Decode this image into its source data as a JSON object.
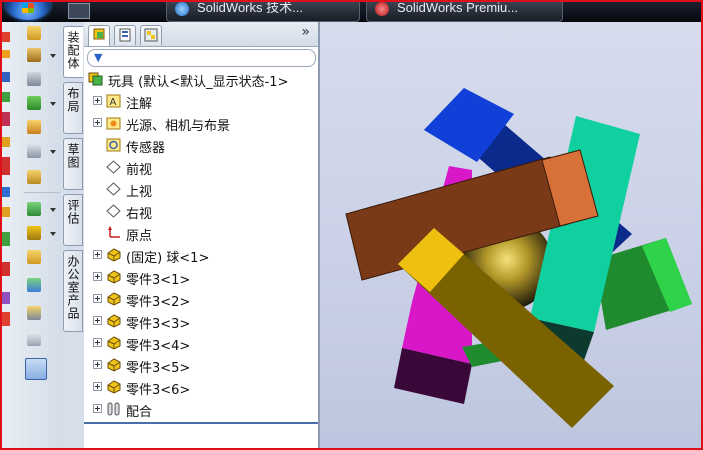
{
  "taskbar": {
    "buttons": [
      {
        "label": "SolidWorks 技术...",
        "icon_color": "#2f8be6"
      },
      {
        "label": "SolidWorks Premiu...",
        "icon_color": "#d2282a"
      }
    ]
  },
  "vertical_tabs": [
    "装配体",
    "布局",
    "草图",
    "评估",
    "办公室产品"
  ],
  "panel": {
    "tabs": [
      "feature-manager",
      "property-manager",
      "configuration-manager"
    ],
    "expand_glyph": "»"
  },
  "tree": {
    "root": "玩具  (默认<默认_显示状态-1>",
    "items": [
      {
        "label": "注解",
        "icon": "annotation-icon",
        "expandable": true
      },
      {
        "label": "光源、相机与布景",
        "icon": "lights-cameras-icon",
        "expandable": true
      },
      {
        "label": "传感器",
        "icon": "sensor-icon",
        "expandable": false
      },
      {
        "label": "前视",
        "icon": "plane-icon",
        "expandable": false
      },
      {
        "label": "上视",
        "icon": "plane-icon",
        "expandable": false
      },
      {
        "label": "右视",
        "icon": "plane-icon",
        "expandable": false
      },
      {
        "label": "原点",
        "icon": "origin-icon",
        "expandable": false
      },
      {
        "label": "(固定) 球<1>",
        "icon": "part-icon",
        "expandable": true
      },
      {
        "label": "零件3<1>",
        "icon": "part-icon",
        "expandable": true
      },
      {
        "label": "零件3<2>",
        "icon": "part-icon",
        "expandable": true
      },
      {
        "label": "零件3<3>",
        "icon": "part-icon",
        "expandable": true
      },
      {
        "label": "零件3<4>",
        "icon": "part-icon",
        "expandable": true
      },
      {
        "label": "零件3<5>",
        "icon": "part-icon",
        "expandable": true
      },
      {
        "label": "零件3<6>",
        "icon": "part-icon",
        "expandable": true
      },
      {
        "label": "配合",
        "icon": "mates-icon",
        "expandable": true
      }
    ]
  },
  "colors": {
    "frame_border": "#e0101a",
    "selection_line": "#4a6fa8",
    "part_icon": "#f0c419"
  }
}
